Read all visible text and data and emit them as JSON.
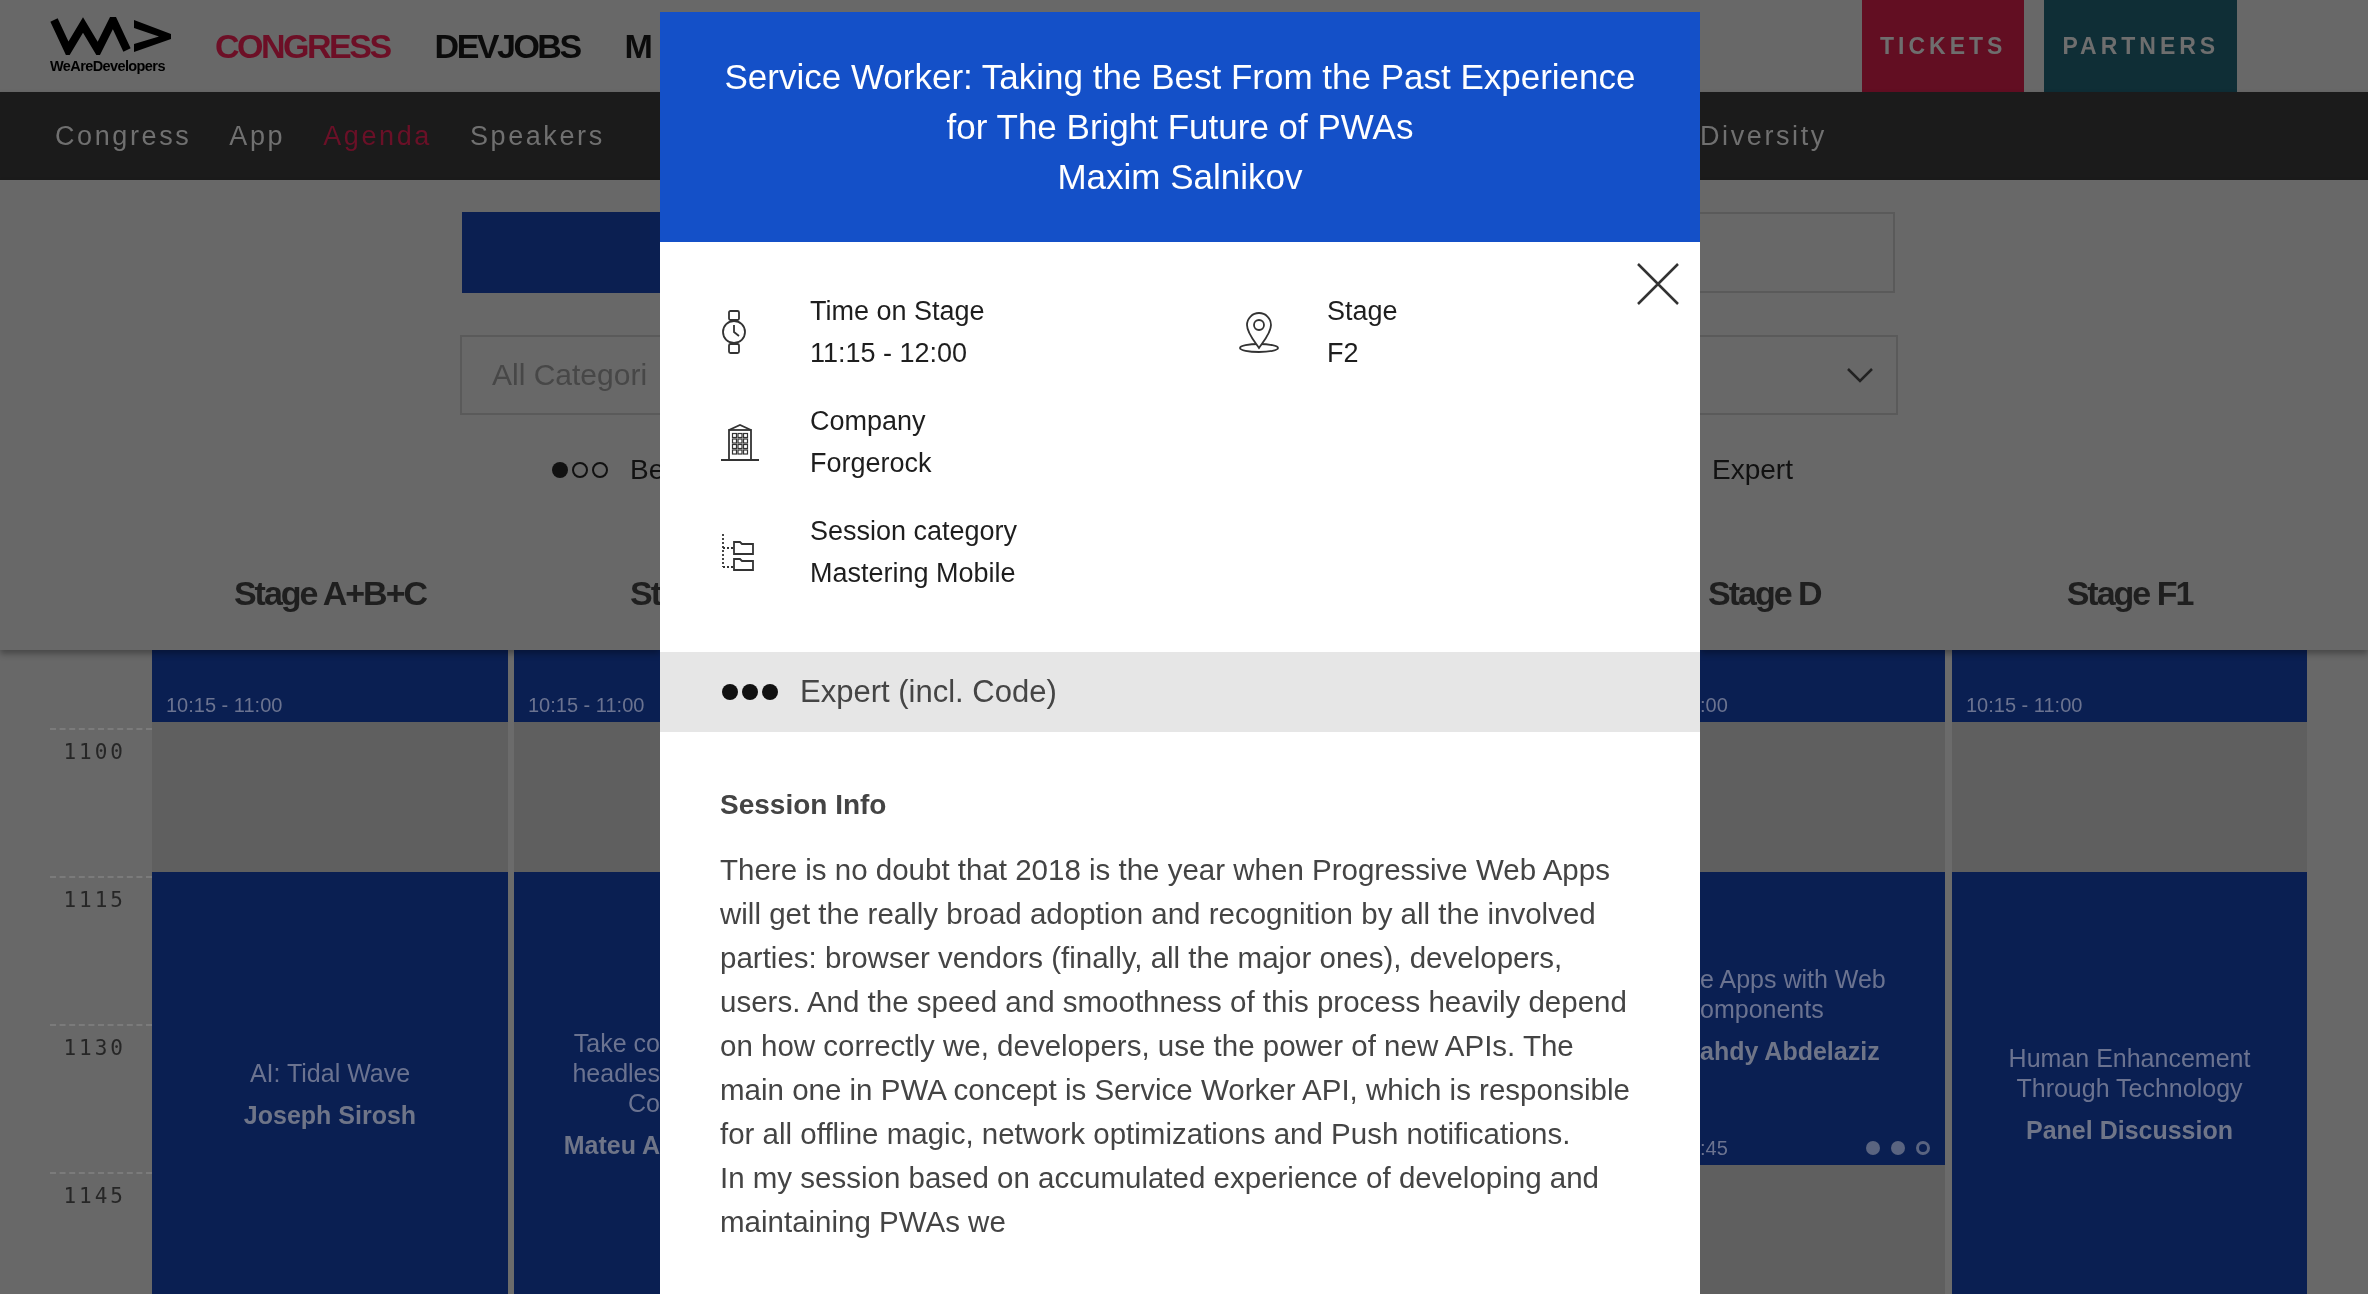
{
  "page_left": {
    "logo": {
      "text": "WeAreDevelopers"
    },
    "brands": [
      {
        "label": "CONGRESS",
        "selected": true
      },
      {
        "label": "DEVJOBS",
        "selected": false
      },
      {
        "label": "M",
        "selected": false
      }
    ],
    "nav": [
      {
        "label": "Congress",
        "selected": false
      },
      {
        "label": "App",
        "selected": false
      },
      {
        "label": "Agenda",
        "selected": true
      },
      {
        "label": "Speakers",
        "selected": false
      }
    ],
    "day_toggle": {
      "selected": true
    },
    "category_select": {
      "value": "All Categori"
    },
    "level_legend": [
      {
        "dots": [
          {
            "filled": true
          },
          {
            "filled": false
          },
          {
            "filled": false
          }
        ],
        "label": "Be"
      }
    ],
    "times": [
      "1100",
      "1115",
      "1130",
      "1145"
    ],
    "columns": [
      {
        "stage": "Stage A+B+C",
        "blocks": [
          {
            "kind": "session",
            "time": "10:15 - 11:00"
          },
          {
            "kind": "break"
          },
          {
            "kind": "session",
            "title": "AI: Tidal Wave",
            "speaker": "Joseph Sirosh"
          }
        ]
      },
      {
        "stage": "St",
        "blocks": [
          {
            "kind": "session",
            "time": "10:15 - 11:00"
          },
          {
            "kind": "break"
          },
          {
            "kind": "session",
            "title": "Take co\nheadles\nCo",
            "speaker": "Mateu A"
          }
        ]
      }
    ]
  },
  "modal": {
    "title": "Service Worker: Taking the Best From the Past Experience for The Bright Future of PWAs",
    "speaker": "Maxim Salnikov",
    "detail_columns": [
      {
        "items": [
          {
            "kind": "time",
            "label": "Time on Stage",
            "value": "11:15 - 12:00"
          },
          {
            "kind": "company",
            "label": "Company",
            "value": "Forgerock"
          },
          {
            "kind": "category",
            "label": "Session category",
            "value": "Mastering Mobile"
          }
        ]
      },
      {
        "items": [
          {
            "kind": "stage",
            "label": "Stage",
            "value": "F2"
          }
        ]
      }
    ],
    "level": {
      "dots": [
        {
          "filled": true
        },
        {
          "filled": true
        },
        {
          "filled": true
        }
      ],
      "label": "Expert (incl. Code)"
    },
    "session_info": {
      "heading": "Session Info",
      "paragraphs": [
        "There is no doubt that 2018 is the year when Progressive Web Apps will get the really broad adoption and recognition by all the involved parties: browser vendors (finally, all the major ones), developers, users. And the speed and smoothness of this process heavily depend on how correctly we, developers, use the power of new APIs. The main one in PWA concept is Service Worker API, which is responsible for all offline magic, network optimizations and Push notifications.",
        "In my session based on accumulated experience of developing and maintaining PWAs we"
      ]
    }
  },
  "page_right": {
    "buttons": [
      {
        "label": "TICKETS",
        "color": "#620e22"
      },
      {
        "label": "PARTNERS",
        "color": "#0f2e36"
      }
    ],
    "nav": [
      {
        "label": "Diversity",
        "selected": false
      }
    ],
    "day_toggle": {
      "selected": false
    },
    "level_legend": [
      {
        "label": "Expert"
      }
    ],
    "columns": [
      {
        "stage": "Stage D",
        "blocks": [
          {
            "kind": "session",
            "time": ":00"
          },
          {
            "kind": "break"
          },
          {
            "kind": "session",
            "title": "e Apps with Web\nomponents",
            "speaker": "ahdy Abdelaziz",
            "time": ":45",
            "dots": [
              {
                "filled": true
              },
              {
                "filled": true
              },
              {
                "filled": false
              }
            ]
          },
          {
            "kind": "break"
          }
        ]
      },
      {
        "stage": "Stage F1",
        "blocks": [
          {
            "kind": "session",
            "time": "10:15 - 11:00"
          },
          {
            "kind": "break"
          },
          {
            "kind": "session",
            "title": "Human Enhancement Through Technology",
            "speaker": "Panel Discussion"
          }
        ]
      }
    ]
  }
}
